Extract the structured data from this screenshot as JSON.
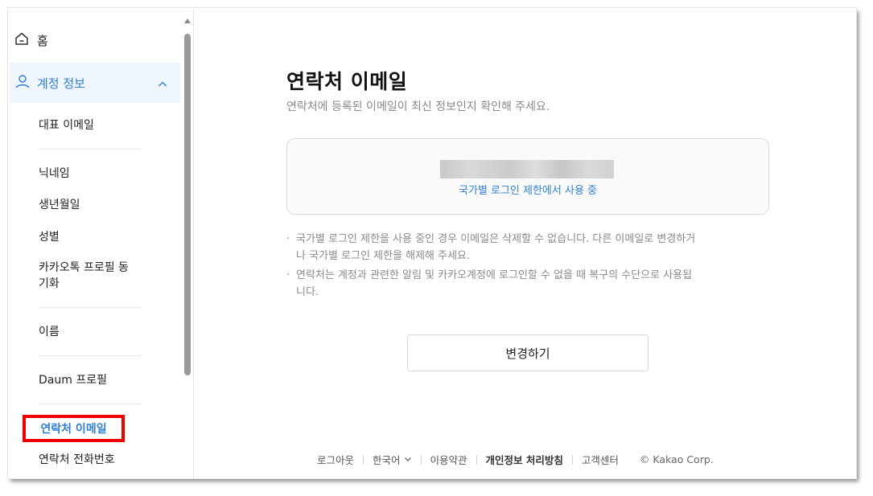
{
  "sidebar": {
    "home_label": "홈",
    "account_label": "계정 정보",
    "items": [
      "대표 이메일",
      "닉네임",
      "생년월일",
      "성별",
      "카카오톡 프로필 동기화",
      "이름",
      "Daum 프로필",
      "연락처 이메일",
      "연락처 전화번호"
    ],
    "active_label": "연락처 이메일",
    "kakao_sync_line1": "카카오톡 프로필 동",
    "kakao_sync_line2": "기화"
  },
  "main": {
    "title": "연락처 이메일",
    "subtitle": "연락처에 등록된 이메일이 최신 정보인지 확인해 주세요.",
    "restriction_link": "국가별 로그인 제한에서 사용 중",
    "notes": [
      "국가별 로그인 제한을 사용 중인 경우 이메일은 삭제할 수 없습니다. 다른 이메일로 변경하거나 국가별 로그인 제한을 해제해 주세요.",
      "연락처는 계정과 관련한 알림 및 카카오계정에 로그인할 수 없을 때 복구의 수단으로 사용됩니다."
    ],
    "note1_line1": "국가별 로그인 제한을 사용 중인 경우 이메일은 삭제할 수 없습니다. 다른 이메일로 변경하거",
    "note1_line2": "나 국가별 로그인 제한을 해제해 주세요.",
    "note2_line1": "연락처는 계정과 관련한 알림 및 카카오계정에 로그인할 수 없을 때 복구의 수단으로 사용됩",
    "note2_line2": "니다.",
    "bullet": "·",
    "change_button": "변경하기"
  },
  "footer": {
    "logout": "로그아웃",
    "language": "한국어",
    "terms": "이용약관",
    "privacy": "개인정보 처리방침",
    "support": "고객센터",
    "copyright": "© Kakao Corp."
  },
  "colors": {
    "accent": "#2f7fd8",
    "active_bg": "#f0f6fd",
    "highlight_border": "#ee0000",
    "muted_text": "#8a8a8a"
  },
  "icons": {
    "home": "home-icon",
    "account": "person-icon",
    "collapse": "chevron-up-icon",
    "language_dropdown": "chevron-down-icon"
  }
}
